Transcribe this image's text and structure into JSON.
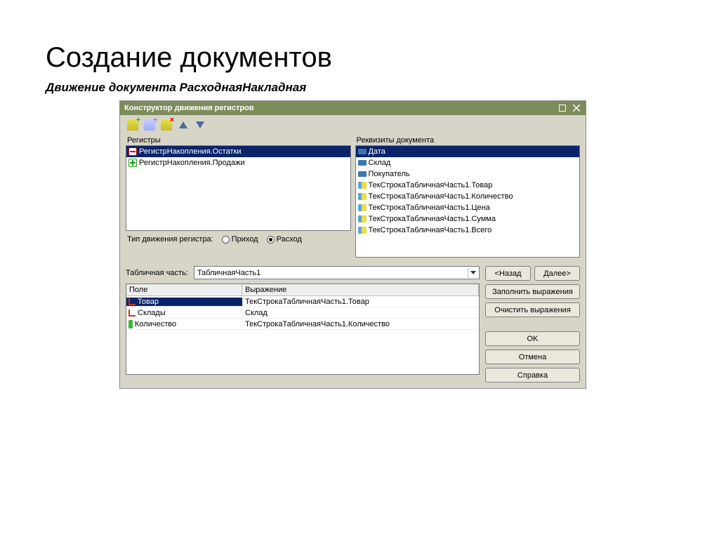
{
  "page_title": "Создание документов",
  "page_subtitle": "Движение документа РасходнаяНакладная",
  "window": {
    "title": "Конструктор движения регистров",
    "registers_label": "Регистры",
    "requisites_label": "Реквизиты документа",
    "movement_type_label": "Тип движения регистра:",
    "radio_income": "Приход",
    "radio_expense": "Расход",
    "table_part_label": "Табличная часть:",
    "table_part_value": "ТабличнаяЧасть1",
    "registers": [
      {
        "label": "РегистрНакопления.Остатки",
        "selected": true,
        "icon": "minus"
      },
      {
        "label": "РегистрНакопления.Продажи",
        "selected": false,
        "icon": "plus"
      }
    ],
    "requisites": [
      {
        "label": "Дата",
        "selected": true,
        "icon": "attr"
      },
      {
        "label": "Склад",
        "selected": false,
        "icon": "attr"
      },
      {
        "label": "Покупатель",
        "selected": false,
        "icon": "attr"
      },
      {
        "label": "ТекСтрокаТабличнаяЧасть1.Товар",
        "selected": false,
        "icon": "attr2"
      },
      {
        "label": "ТекСтрокаТабличнаяЧасть1.Количество",
        "selected": false,
        "icon": "attr2"
      },
      {
        "label": "ТекСтрокаТабличнаяЧасть1.Цена",
        "selected": false,
        "icon": "attr2"
      },
      {
        "label": "ТекСтрокаТабличнаяЧасть1.Сумма",
        "selected": false,
        "icon": "attr2"
      },
      {
        "label": "ТекСтрокаТабличнаяЧасть1.Всего",
        "selected": false,
        "icon": "attr2"
      }
    ],
    "table_headers": {
      "field": "Поле",
      "expression": "Выражение"
    },
    "table_rows": [
      {
        "field": "Товар",
        "expression": "ТекСтрокаТабличнаяЧасть1.Товар",
        "selected": true,
        "icon": "redl"
      },
      {
        "field": "Склады",
        "expression": "Склад",
        "selected": false,
        "icon": "redl"
      },
      {
        "field": "Количество",
        "expression": "ТекСтрокаТабличнаяЧасть1.Количество",
        "selected": false,
        "icon": "green"
      }
    ],
    "buttons": {
      "back": "<Назад",
      "next": "Далее>",
      "fill_expr": "Заполнить выражения",
      "clear_expr": "Очистить выражения",
      "ok": "OK",
      "cancel": "Отмена",
      "help": "Справка"
    }
  }
}
